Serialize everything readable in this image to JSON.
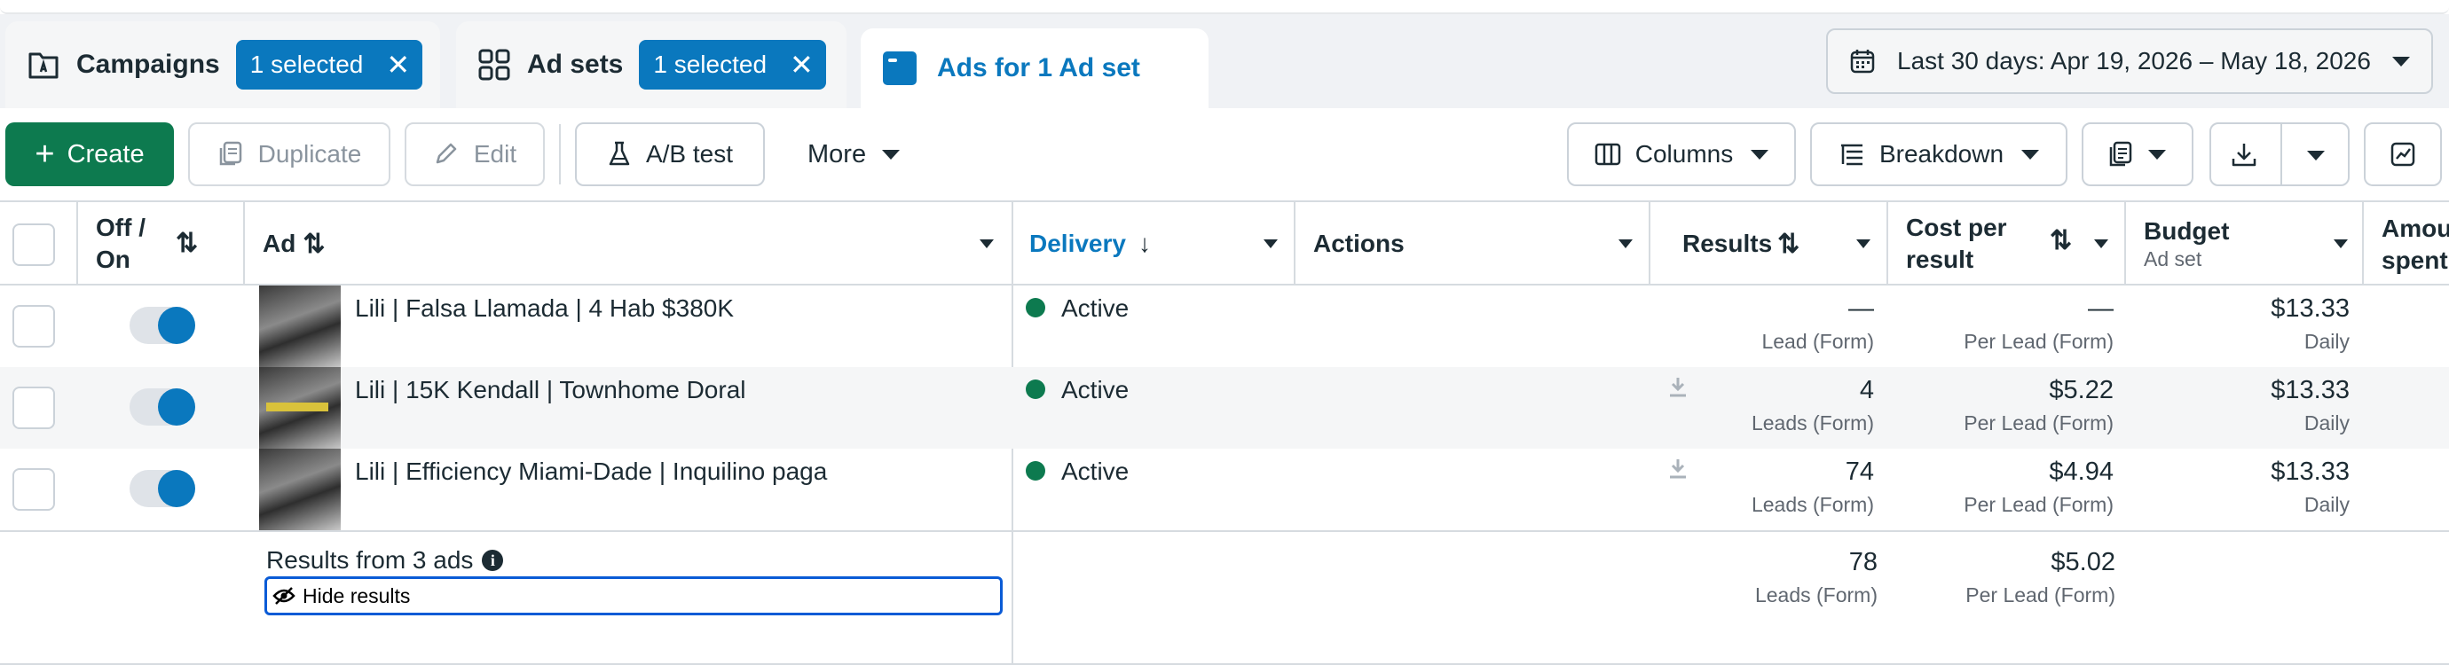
{
  "tabs": {
    "campaigns": {
      "label": "Campaigns",
      "badge": "1 selected"
    },
    "adsets": {
      "label": "Ad sets",
      "badge": "1 selected"
    },
    "ads": {
      "label": "Ads for 1 Ad set"
    }
  },
  "date_range": "Last 30 days: Apr 19, 2026 – May 18, 2026",
  "toolbar": {
    "create": "Create",
    "duplicate": "Duplicate",
    "edit": "Edit",
    "ab_test": "A/B test",
    "more": "More",
    "columns": "Columns",
    "breakdown": "Breakdown"
  },
  "columns": {
    "off_on": "Off / On",
    "ad": "Ad",
    "delivery": "Delivery",
    "actions": "Actions",
    "results": "Results",
    "cost_per_result": "Cost per result",
    "budget": "Budget",
    "budget_sub": "Ad set",
    "amount_spent": "Amount spent"
  },
  "rows": [
    {
      "name": "Lili | Falsa Llamada | 4 Hab $380K",
      "status": "Active",
      "results": "—",
      "results_label": "Lead (Form)",
      "cost": "—",
      "cost_label": "Per Lead (Form)",
      "budget": "$13.33",
      "budget_label": "Daily"
    },
    {
      "name": "Lili | 15K Kendall | Townhome Doral",
      "status": "Active",
      "results": "4",
      "results_label": "Leads (Form)",
      "cost": "$5.22",
      "cost_label": "Per Lead (Form)",
      "budget": "$13.33",
      "budget_label": "Daily"
    },
    {
      "name": "Lili | Efficiency Miami-Dade | Inquilino paga",
      "status": "Active",
      "results": "74",
      "results_label": "Leads (Form)",
      "cost": "$4.94",
      "cost_label": "Per Lead (Form)",
      "budget": "$13.33",
      "budget_label": "Daily"
    }
  ],
  "summary": {
    "title": "Results from 3 ads",
    "hide": "Hide results",
    "results": "78",
    "results_label": "Leads (Form)",
    "cost": "$5.02",
    "cost_label": "Per Lead (Form)"
  }
}
